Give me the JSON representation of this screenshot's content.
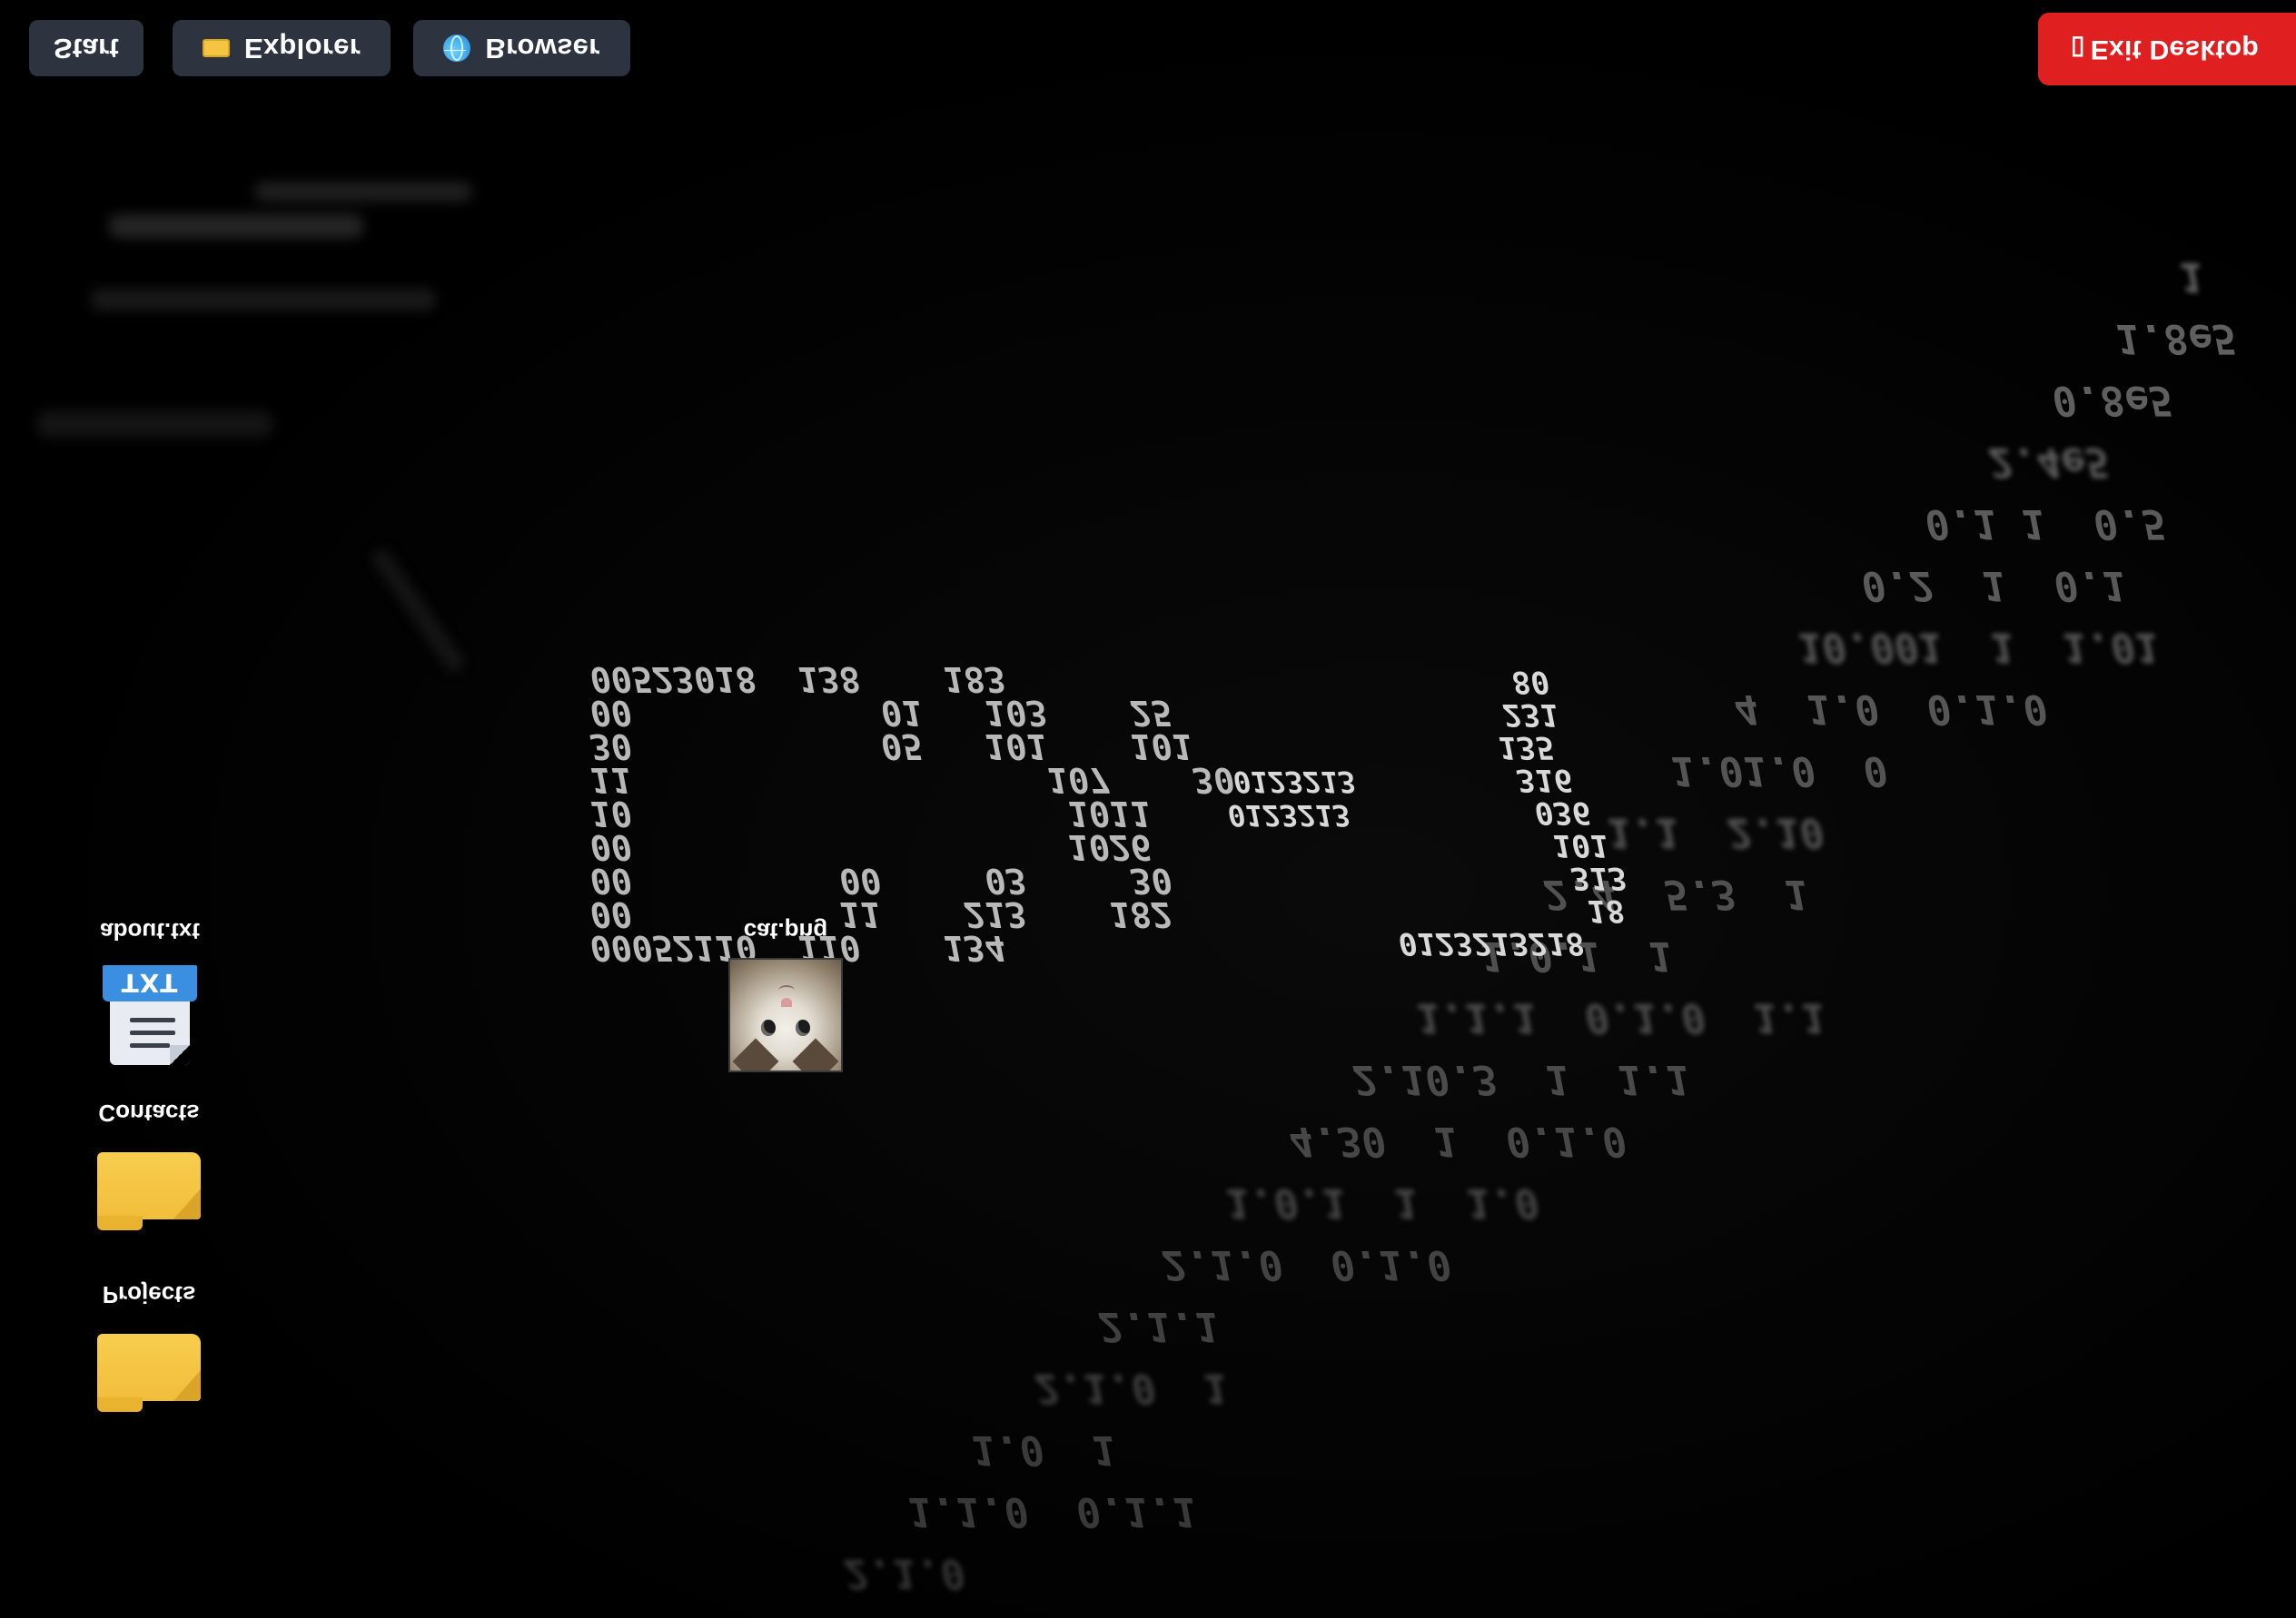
{
  "taskbar": {
    "start_label": "Start",
    "explorer_label": "Explorer",
    "browser_label": "Browser",
    "exit_label": "Exit Desktop",
    "exit_glyph": "\u0000"
  },
  "desktop_icons": {
    "about": {
      "label": "about.txt",
      "tag": "TXT"
    },
    "contacts": {
      "label": "Contacts"
    },
    "projects": {
      "label": "Projects"
    },
    "cat": {
      "label": "cat.png"
    }
  },
  "wallpaper": {
    "rows": [
      "00523018  138    183",
      "00            01   103    25",
      "30            05   101    101",
      "11                    107    30",
      "10                     1011",
      "00                     1026",
      "00          00     03     30",
      "00          11    213    182",
      "00052110  110    134"
    ],
    "mid_top": "0123213",
    "mid_bottom": "0123213",
    "right_col": [
      "80",
      "231",
      "135",
      "316",
      "036",
      "101",
      "313",
      "18",
      "0123213218"
    ],
    "streak": [
      "1",
      "1.8e5",
      "0.8e5",
      "2.4e5",
      "0.1 1  0.5",
      "0.2  1  0.1",
      "10.001  1  1.01",
      "4  1.0  0.1.0",
      "1.01.0  0",
      "1.1  2.10",
      "2.4  5.3  1",
      "1.0.1  1",
      "1.1.1  0.1.0  1.1",
      "2.10.3  1  1.1",
      "4.30  1  0.1.0",
      "1.0.1  1  1.0",
      "2.1.0  0.1.0",
      "2.1.1",
      "2.1.0  1",
      "1.0  1",
      "1.1.0  0.1.1",
      "2.1.0"
    ]
  },
  "colors": {
    "taskbar_button": "#2d3440",
    "exit_button": "#e02020",
    "folder": "#f5c542",
    "txt_tag": "#3a8fe0"
  }
}
